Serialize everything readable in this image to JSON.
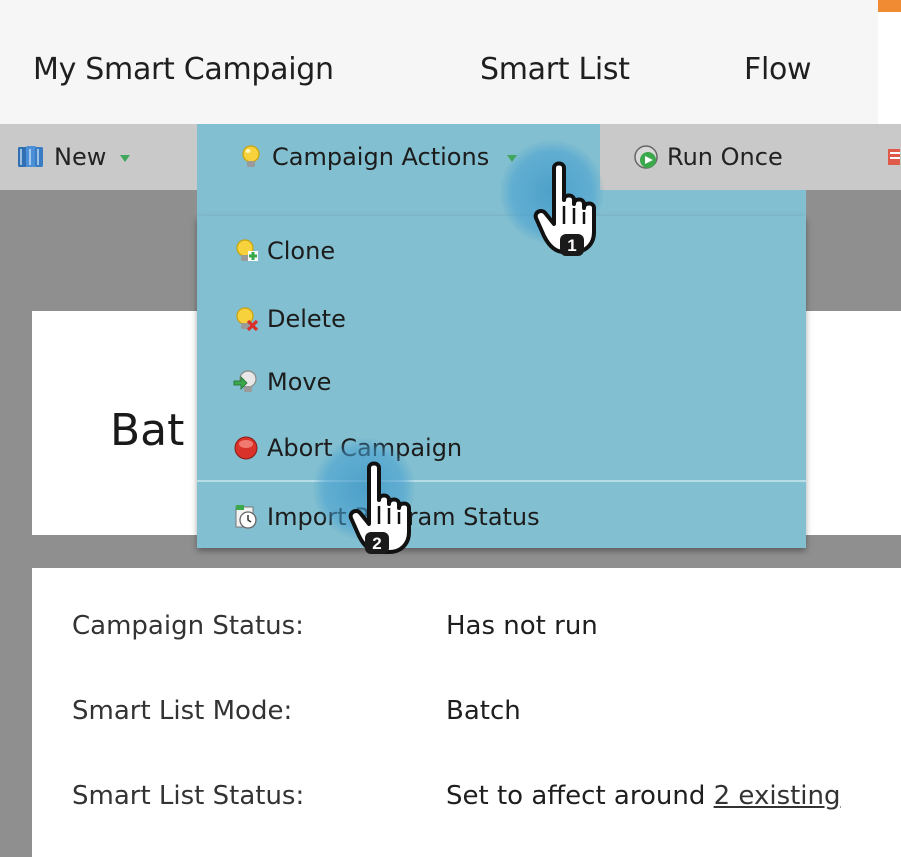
{
  "tabs": [
    "My Smart Campaign",
    "Smart List",
    "Flow"
  ],
  "toolbar": {
    "new_label": "New",
    "campaign_actions_label": "Campaign Actions",
    "run_once_label": "Run Once"
  },
  "menu": {
    "items": [
      "Clone",
      "Delete",
      "Move",
      "Abort Campaign",
      "Import Program Status"
    ]
  },
  "page": {
    "title_partial": "Bat"
  },
  "details": {
    "campaign_status_label": "Campaign Status:",
    "campaign_status_value": "Has not run",
    "mode_label": "Smart List Mode:",
    "mode_value": "Batch",
    "list_status_label": "Smart List Status:",
    "list_status_prefix": "Set to affect around ",
    "list_status_link": "2 existing"
  },
  "callouts": [
    "1",
    "2"
  ],
  "colors": {
    "menu_bg": "#82bfd0",
    "toolbar_bg": "#c9c9c9",
    "accent": "#f08a33",
    "dropdown_arrow": "#3fa65c"
  },
  "icons": {
    "new": "book-icon",
    "campaign_actions": "lightbulb-icon",
    "run_once": "run-once-icon",
    "clone": "clone-lightbulb-icon",
    "delete": "delete-lightbulb-icon",
    "move": "move-lightbulb-icon",
    "abort": "abort-red-dot-icon",
    "import": "import-status-icon",
    "cursor": "hand-pointer-icon"
  }
}
